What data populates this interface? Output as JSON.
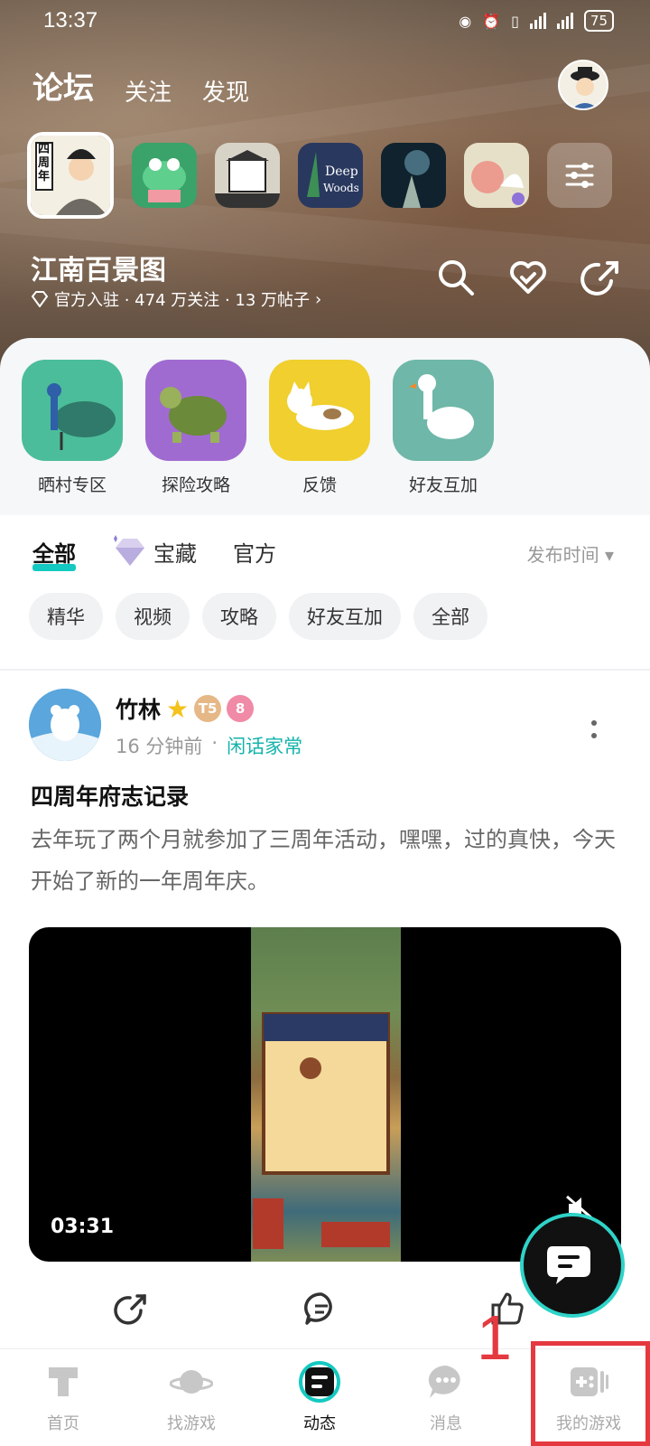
{
  "status_bar": {
    "time": "13:37",
    "battery": "75",
    "network": "4G"
  },
  "header": {
    "tabs": [
      "论坛",
      "关注",
      "发现"
    ],
    "active_tab": "论坛"
  },
  "game": {
    "name": "江南百景图",
    "meta": "官方入驻 · 474 万关注 · 13 万帖子",
    "selected_thumb_text": "四周年",
    "thumbs": [
      "江南百景图",
      "game-frog",
      "game-bakery",
      "深林 Deep in the Woods",
      "game-night",
      "game-bird"
    ]
  },
  "zones": [
    {
      "label": "晒村专区",
      "bg": "#4cbd9a"
    },
    {
      "label": "探险攻略",
      "bg": "#a06bd1"
    },
    {
      "label": "反馈",
      "bg": "#f0cf2e"
    },
    {
      "label": "好友互加",
      "bg": "#6fb7a8"
    }
  ],
  "sort": {
    "tabs": [
      "全部",
      "宝藏",
      "官方"
    ],
    "order": "发布时间 ▾",
    "chips": [
      "精华",
      "视频",
      "攻略",
      "好友互加",
      "全部"
    ]
  },
  "post": {
    "author": "竹林",
    "time": "16 分钟前",
    "topic": "闲话家常",
    "level_badge": "T5",
    "level_num": "8",
    "title": "四周年府志记录",
    "body": "去年玩了两个月就参加了三周年活动，嘿嘿，过的真快，今天开始了新的一年周年庆。",
    "video_duration": "03:31"
  },
  "bottom_nav": [
    {
      "label": "首页",
      "icon": "home-icon"
    },
    {
      "label": "找游戏",
      "icon": "planet-icon"
    },
    {
      "label": "动态",
      "icon": "feed-icon"
    },
    {
      "label": "消息",
      "icon": "message-icon"
    },
    {
      "label": "我的游戏",
      "icon": "gamepad-icon"
    }
  ],
  "annotation": {
    "number": "1"
  },
  "colors": {
    "accent": "#14c9c1",
    "highlight": "#e53940"
  }
}
